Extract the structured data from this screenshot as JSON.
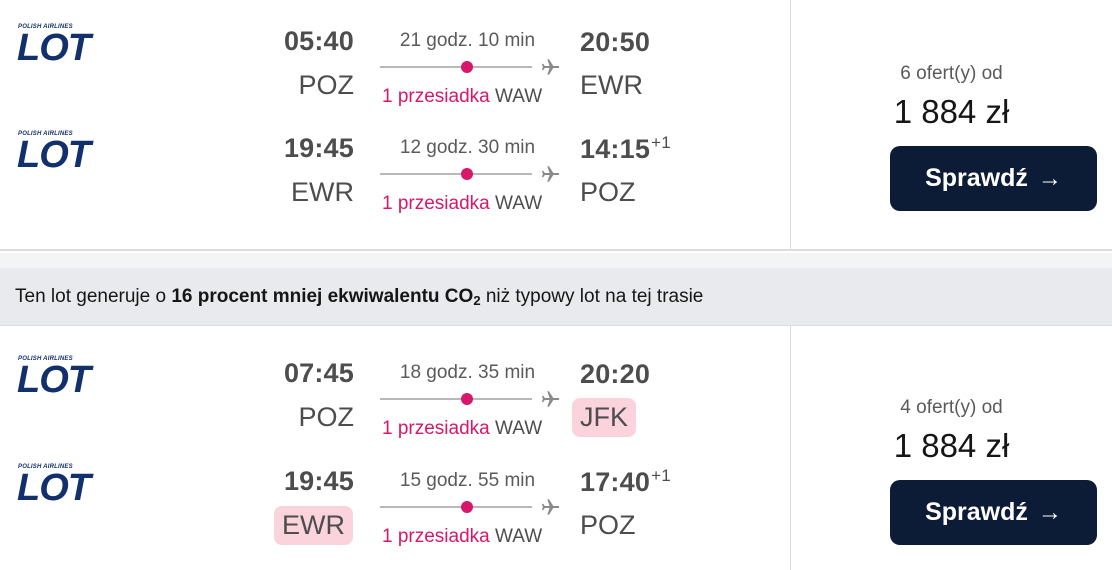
{
  "results": [
    {
      "legs": [
        {
          "airline_logo": {
            "tagline": "POLISH AIRLINES",
            "wordmark": "LOT"
          },
          "dep_time": "05:40",
          "dep_code": "POZ",
          "duration": "21 godz. 10 min",
          "stops_label": "1 przesiadka",
          "stop_airport": "WAW",
          "arr_time": "20:50",
          "arr_day_offset": "",
          "arr_code": "EWR"
        },
        {
          "airline_logo": {
            "tagline": "POLISH AIRLINES",
            "wordmark": "LOT"
          },
          "dep_time": "19:45",
          "dep_code": "EWR",
          "duration": "12 godz. 30 min",
          "stops_label": "1 przesiadka",
          "stop_airport": "WAW",
          "arr_time": "14:15",
          "arr_day_offset": "+1",
          "arr_code": "POZ"
        }
      ],
      "offers": "6 ofert(y) od",
      "price": "1 884 zł",
      "button_label": "Sprawdź"
    },
    {
      "legs": [
        {
          "airline_logo": {
            "tagline": "POLISH AIRLINES",
            "wordmark": "LOT"
          },
          "dep_time": "07:45",
          "dep_code": "POZ",
          "duration": "18 godz. 35 min",
          "stops_label": "1 przesiadka",
          "stop_airport": "WAW",
          "arr_time": "20:20",
          "arr_day_offset": "",
          "arr_code": "JFK"
        },
        {
          "airline_logo": {
            "tagline": "POLISH AIRLINES",
            "wordmark": "LOT"
          },
          "dep_time": "19:45",
          "dep_code": "EWR",
          "duration": "15 godz. 55 min",
          "stops_label": "1 przesiadka",
          "stop_airport": "WAW",
          "arr_time": "17:40",
          "arr_day_offset": "+1",
          "arr_code": "POZ"
        }
      ],
      "offers": "4 ofert(y) od",
      "price": "1 884 zł",
      "button_label": "Sprawdź"
    }
  ],
  "eco_notice": {
    "prefix": "Ten lot generuje o ",
    "bold": "16 procent mniej ekwiwalentu CO",
    "bold_sub": "2",
    "suffix": " niż typowy lot na tej trasie"
  },
  "colors": {
    "accent_pink": "#d6176a",
    "highlight_bg": "#fbd3dc",
    "button_bg": "#0c1c37",
    "logo_blue": "#12306b"
  },
  "icons": {
    "plane": "plane-icon",
    "arrow": "arrow-right-icon"
  }
}
